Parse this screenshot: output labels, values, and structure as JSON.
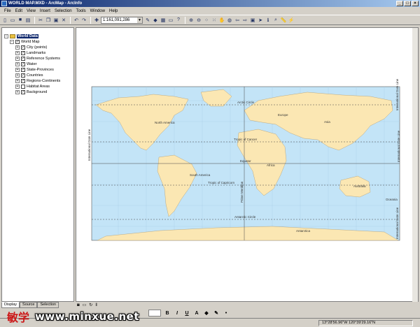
{
  "window": {
    "title": "WORLD MAP.MXD - ArcMap - ArcInfo"
  },
  "menu": [
    "File",
    "Edit",
    "View",
    "Insert",
    "Selection",
    "Tools",
    "Window",
    "Help"
  ],
  "toolbar": {
    "scale_value": "1:161,091,286"
  },
  "toc": {
    "data_frame": "World Data",
    "group": "World Map",
    "layers": [
      {
        "label": "City (points)",
        "checked": true
      },
      {
        "label": "Landmarks",
        "checked": true
      },
      {
        "label": "Reference Systems",
        "checked": true
      },
      {
        "label": "Water",
        "checked": true
      },
      {
        "label": "State-Provinces",
        "checked": true
      },
      {
        "label": "Countries",
        "checked": true
      },
      {
        "label": "Regions-Continents",
        "checked": true
      },
      {
        "label": "Habitat Areas",
        "checked": false
      },
      {
        "label": "Background",
        "checked": true
      }
    ],
    "tabs": [
      "Display",
      "Source",
      "Selection"
    ]
  },
  "map": {
    "labels": {
      "arctic_circle": "Arctic Circle",
      "tropic_cancer": "Tropic of Cancer",
      "equator": "Equator",
      "tropic_capricorn": "Tropic of Capricorn",
      "antarctic_circle": "Antarctic Circle",
      "prime_meridian": "Prime Meridian",
      "date_line": "International Date Line",
      "north_america": "North America",
      "south_america": "South America",
      "europe": "Europe",
      "asia": "Asia",
      "africa": "Africa",
      "australia": "Australia",
      "oceania": "Oceania",
      "antarctica": "Antarctica"
    },
    "colors": {
      "ocean": "#c3e4f7",
      "land": "#fbe7b3",
      "grid": "#8fb8d8"
    }
  },
  "status": {
    "coordinates": "13°28'56.96\"W  120°39'29.16\"N"
  },
  "watermark": {
    "logo": "敏学",
    "url": "www.minxue.net"
  }
}
